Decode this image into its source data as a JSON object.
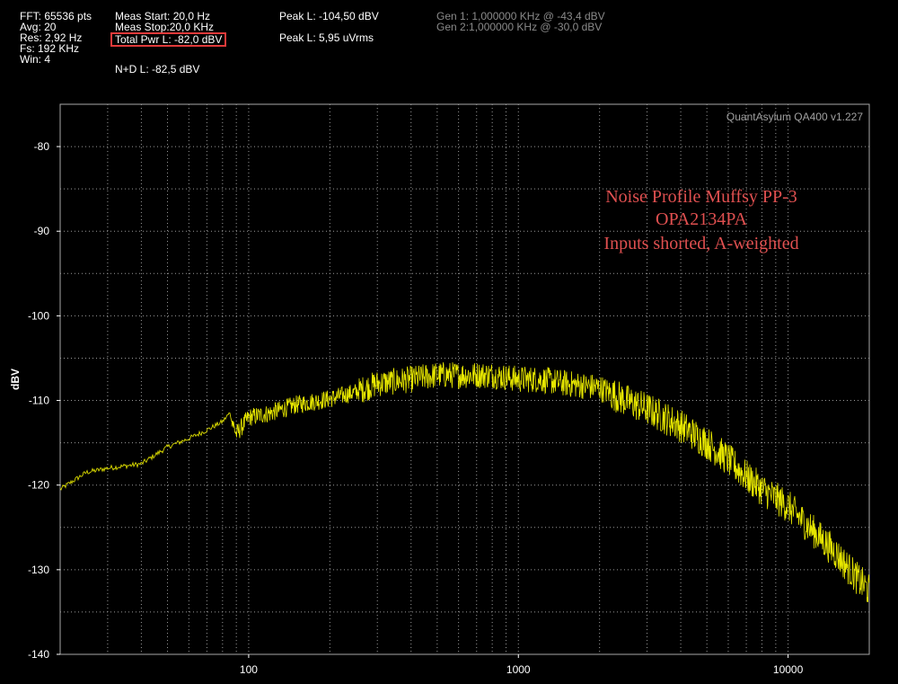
{
  "header": {
    "col1": [
      "FFT: 65536 pts",
      "Avg: 20",
      "Res: 2,92 Hz",
      "Fs: 192 KHz",
      "Win: 4"
    ],
    "meas_start": "Meas Start: 20,0 Hz",
    "meas_stop": "Meas Stop:20,0 KHz",
    "total_pwr": "Total Pwr L: -82,0 dBV",
    "nd": "N+D L: -82,5 dBV",
    "peak_dbv": "Peak L: -104,50 dBV",
    "peak_uv": "Peak L: 5,95 uVrms",
    "gen1": "Gen 1: 1,000000 KHz @ -43,4  dBV",
    "gen2": "Gen 2:1,000000 KHz @ -30,0  dBV"
  },
  "colors": {
    "trace": "#ffff00",
    "accent_box": "#e03a3a",
    "annotation": "#e05050"
  },
  "chart_data": {
    "type": "line",
    "ylabel": "dBV",
    "xscale": "log",
    "xlim": [
      20,
      20000
    ],
    "ylim": [
      -140,
      -75
    ],
    "x_ticks": [
      100,
      1000,
      10000
    ],
    "x_tick_labels": [
      "100",
      "1000",
      "10000"
    ],
    "y_ticks": [
      -80,
      -90,
      -100,
      -110,
      -120,
      -130,
      -140
    ],
    "y_tick_labels": [
      "-80",
      "-90",
      "-100",
      "-110",
      "-120",
      "-130",
      "-140"
    ],
    "grid": true,
    "watermark": "QuantAsylum QA400 v1.227",
    "annotation": [
      "Noise Profile Muffsy PP-3",
      "OPA2134PA",
      "Inputs shorted, A-weighted"
    ],
    "series": [
      {
        "x": [
          20,
          25,
          30,
          40,
          50,
          60,
          70,
          80,
          85,
          90,
          100,
          120,
          150,
          200,
          250,
          300,
          400,
          500,
          600,
          700,
          800,
          1000,
          1200,
          1500,
          2000,
          2500,
          3000,
          4000,
          5000,
          6000,
          7000,
          8000,
          10000,
          12000,
          15000,
          18000,
          20000
        ],
        "values": [
          -120.5,
          -118.5,
          -118,
          -117.5,
          -115.5,
          -114.5,
          -113.5,
          -112.5,
          -111.5,
          -114,
          -112,
          -111.5,
          -110.5,
          -109.8,
          -109,
          -108,
          -107.5,
          -107,
          -107,
          -107,
          -107,
          -107.5,
          -107.5,
          -108,
          -108.5,
          -110,
          -111,
          -113,
          -115,
          -117,
          -119,
          -120.5,
          -122.5,
          -125,
          -128,
          -131,
          -132.5
        ]
      }
    ]
  }
}
